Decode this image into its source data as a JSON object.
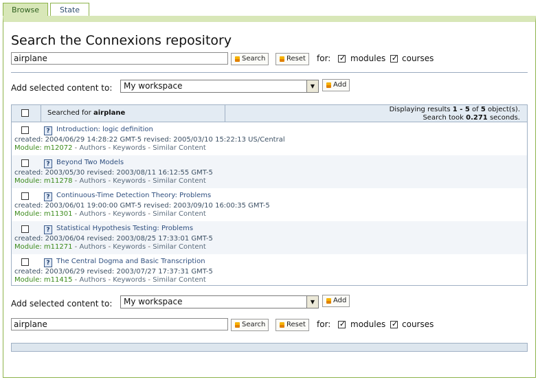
{
  "tabs": [
    {
      "label": "Browse"
    },
    {
      "label": "State"
    }
  ],
  "page_title": "Search the Connexions repository",
  "search": {
    "value": "airplane",
    "search_label": "Search",
    "reset_label": "Reset",
    "for_label": "for:",
    "modules_label": "modules",
    "courses_label": "courses",
    "modules_checked": true,
    "courses_checked": true
  },
  "add": {
    "label": "Add selected content to:",
    "selected": "My workspace",
    "button": "Add"
  },
  "results": {
    "searched_prefix": "Searched for",
    "searched_term": "airplane",
    "display_prefix": "Displaying results",
    "range": "1 - 5",
    "of_text": "of",
    "total": "5",
    "unit": "object(s).",
    "took_prefix": "Search took",
    "time": "0.271",
    "seconds": "seconds.",
    "items": [
      {
        "title": "Introduction: logic definition",
        "meta": "created: 2004/06/29 14:28:22 GMT-5 revised: 2005/03/10 15:22:13 US/Central",
        "module": "Module: m12072"
      },
      {
        "title": "Beyond Two Models",
        "meta": "created: 2003/05/30 revised: 2003/08/11 16:12:55 GMT-5",
        "module": "Module: m11278"
      },
      {
        "title": "Continuous-Time Detection Theory: Problems",
        "meta": "created: 2003/06/01 19:00:00 GMT-5 revised: 2003/09/10 16:00:35 GMT-5",
        "module": "Module: m11301"
      },
      {
        "title": "Statistical Hypothesis Testing: Problems",
        "meta": "created: 2003/06/04 revised: 2003/08/25 17:33:01 GMT-5",
        "module": "Module: m11271"
      },
      {
        "title": "The Central Dogma and Basic Transcription",
        "meta": "created: 2003/06/29 revised: 2003/07/27 17:37:31 GMT-5",
        "module": "Module: m11415"
      }
    ],
    "links": {
      "authors": "Authors",
      "keywords": "Keywords",
      "similar": "Similar Content",
      "sep": " - "
    }
  },
  "icons": {
    "button_icon": "arrow-icon",
    "select_arrow": "chevron-down-icon",
    "item_icon": "help-icon"
  },
  "colors": {
    "tab_active_bg": "#d8e7b8",
    "border_green": "#8cb24a",
    "link_blue": "#2f4f7f",
    "module_green": "#3a8a1a"
  }
}
